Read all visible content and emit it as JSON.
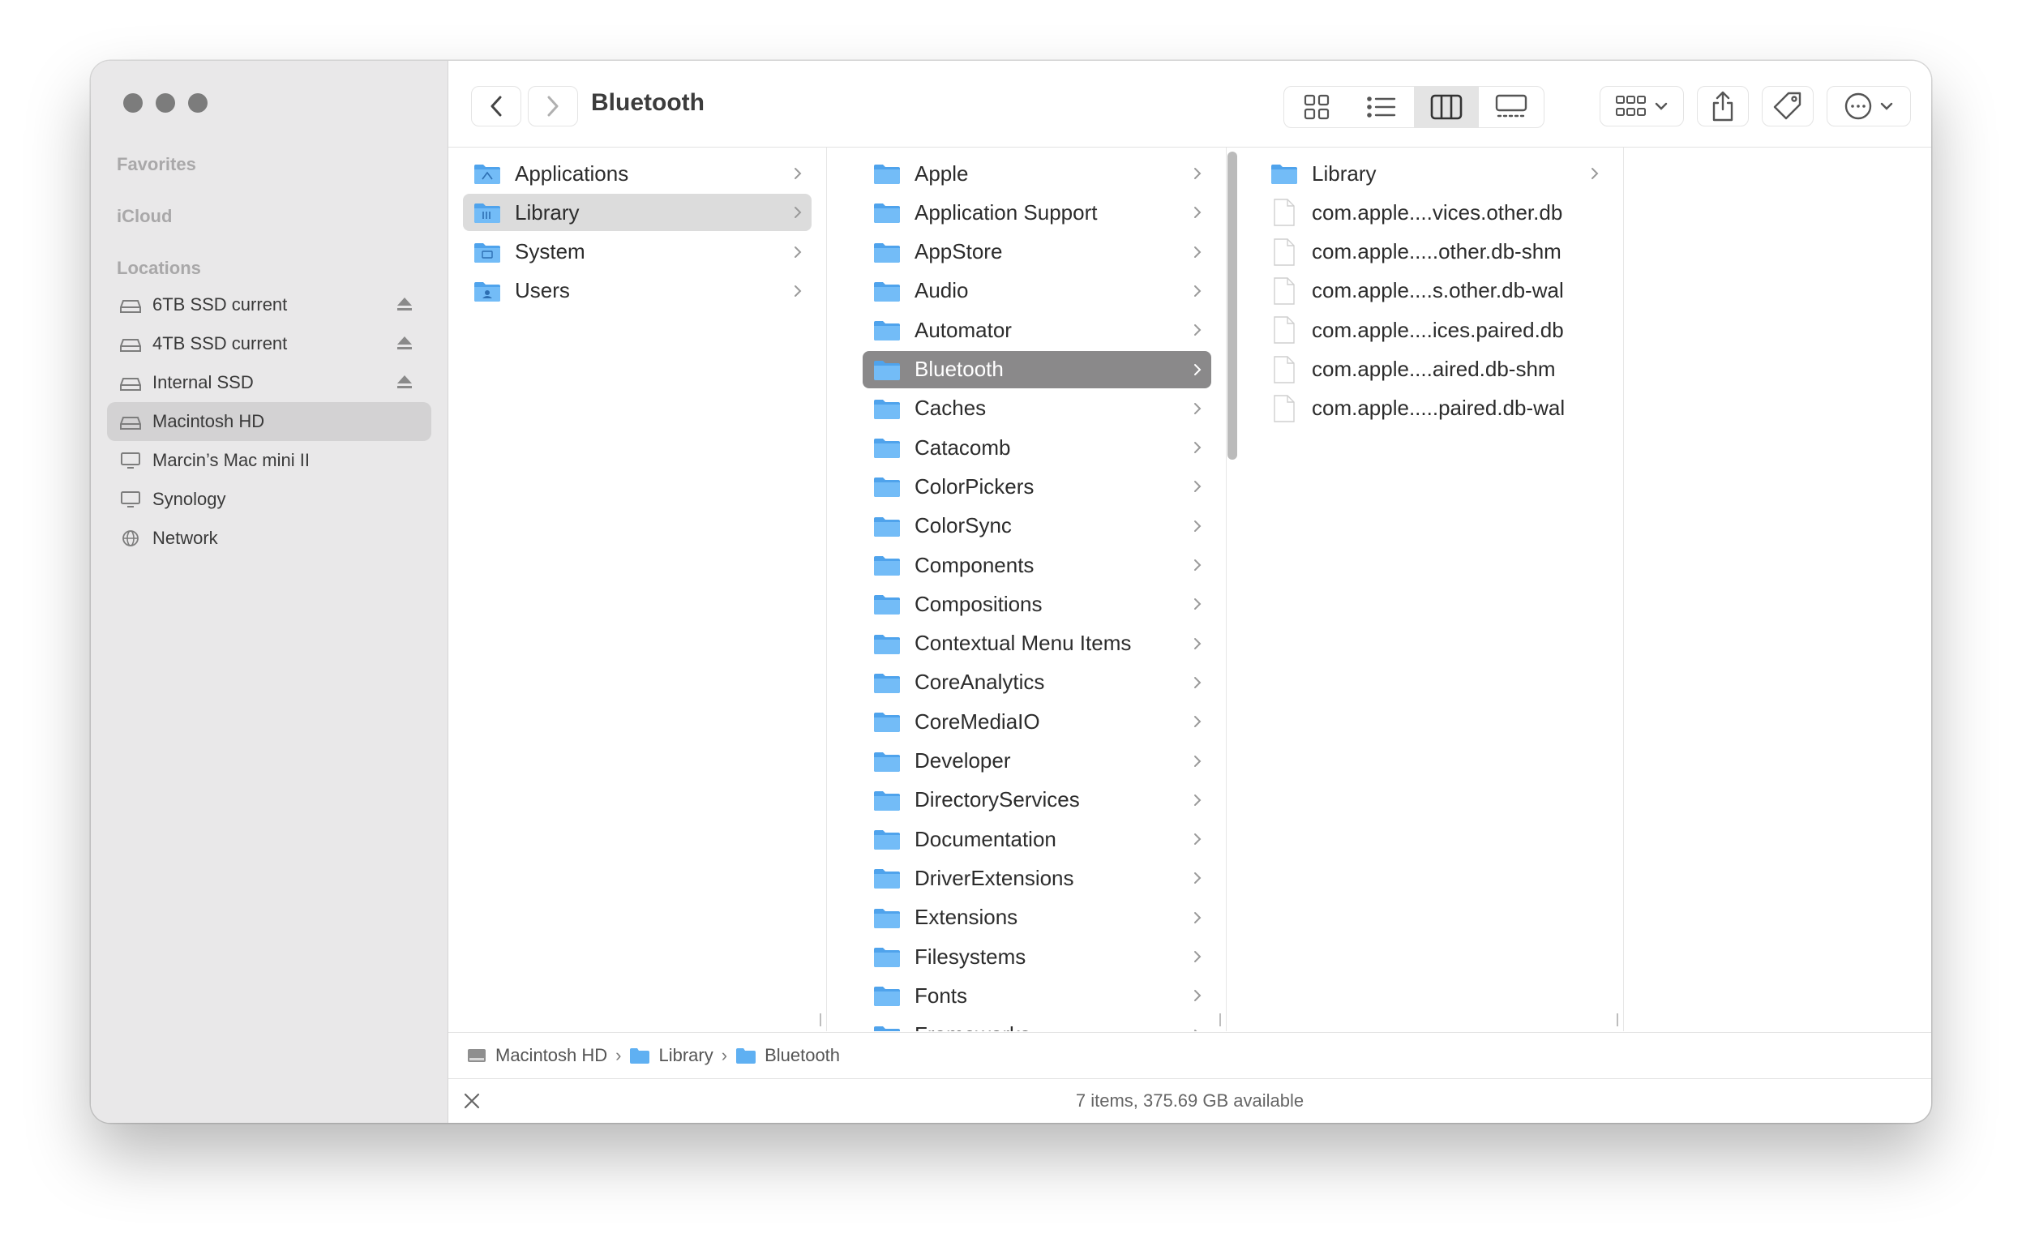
{
  "window_title": "Bluetooth",
  "sidebar": {
    "sections": {
      "favorites": "Favorites",
      "icloud": "iCloud",
      "locations": "Locations"
    },
    "locations": [
      {
        "label": "6TB SSD current",
        "icon": "external-drive-icon",
        "eject": true
      },
      {
        "label": "4TB SSD current",
        "icon": "external-drive-icon",
        "eject": true
      },
      {
        "label": "Internal SSD",
        "icon": "external-drive-icon",
        "eject": true
      },
      {
        "label": "Macintosh HD",
        "icon": "internal-drive-icon",
        "eject": false,
        "selected": true
      },
      {
        "label": "Marcin’s Mac mini II",
        "icon": "computer-icon",
        "eject": false
      },
      {
        "label": "Synology",
        "icon": "server-icon",
        "eject": false
      },
      {
        "label": "Network",
        "icon": "globe-icon",
        "eject": false
      }
    ]
  },
  "columns": [
    {
      "items": [
        {
          "label": "Applications",
          "kind": "folder-apps",
          "selected": false
        },
        {
          "label": "Library",
          "kind": "folder-library",
          "selected": true
        },
        {
          "label": "System",
          "kind": "folder-system",
          "selected": false
        },
        {
          "label": "Users",
          "kind": "folder-users",
          "selected": false
        }
      ]
    },
    {
      "items": [
        {
          "label": "Apple"
        },
        {
          "label": "Application Support"
        },
        {
          "label": "AppStore"
        },
        {
          "label": "Audio"
        },
        {
          "label": "Automator"
        },
        {
          "label": "Bluetooth",
          "selected": true
        },
        {
          "label": "Caches"
        },
        {
          "label": "Catacomb"
        },
        {
          "label": "ColorPickers"
        },
        {
          "label": "ColorSync"
        },
        {
          "label": "Components"
        },
        {
          "label": "Compositions"
        },
        {
          "label": "Contextual Menu Items"
        },
        {
          "label": "CoreAnalytics"
        },
        {
          "label": "CoreMediaIO"
        },
        {
          "label": "Developer"
        },
        {
          "label": "DirectoryServices"
        },
        {
          "label": "Documentation"
        },
        {
          "label": "DriverExtensions"
        },
        {
          "label": "Extensions"
        },
        {
          "label": "Filesystems"
        },
        {
          "label": "Fonts"
        },
        {
          "label": "Frameworks"
        }
      ]
    },
    {
      "items": [
        {
          "label": "Library",
          "kind": "folder"
        },
        {
          "label": "com.apple....vices.other.db",
          "kind": "file"
        },
        {
          "label": "com.apple.....other.db-shm",
          "kind": "file"
        },
        {
          "label": "com.apple....s.other.db-wal",
          "kind": "file"
        },
        {
          "label": "com.apple....ices.paired.db",
          "kind": "file"
        },
        {
          "label": "com.apple....aired.db-shm",
          "kind": "file"
        },
        {
          "label": "com.apple.....paired.db-wal",
          "kind": "file"
        }
      ]
    }
  ],
  "pathbar": [
    "Macintosh HD",
    "Library",
    "Bluetooth"
  ],
  "status": "7 items, 375.69 GB available",
  "colors": {
    "sidebar_bg": "#e9e8e9",
    "selection_dark": "#8a898a",
    "folder_blue": "#62b5f5"
  }
}
